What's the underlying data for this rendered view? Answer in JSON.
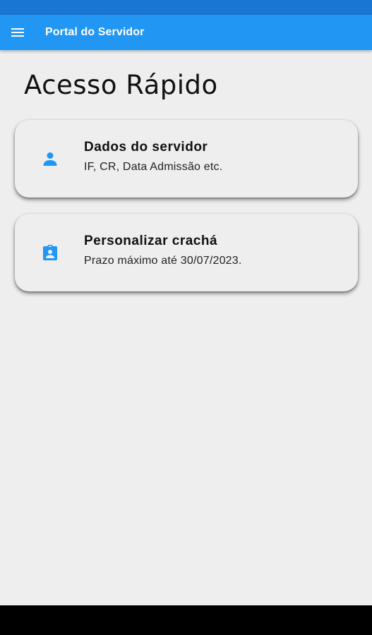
{
  "app_bar": {
    "title": "Portal do Servidor",
    "icon": "menu-icon",
    "color": "#2196f3"
  },
  "status_bar": {
    "color": "#1976d2"
  },
  "page": {
    "title": "Acesso Rápido"
  },
  "cards": [
    {
      "title": "Dados do servidor",
      "subtitle": "IF, CR, Data Admissão etc.",
      "icon": "person-icon"
    },
    {
      "title": "Personalizar crachá",
      "subtitle": "Prazo máximo até 30/07/2023.",
      "icon": "badge-icon"
    }
  ],
  "colors": {
    "accent": "#2196f3",
    "background": "#eeeeee"
  }
}
